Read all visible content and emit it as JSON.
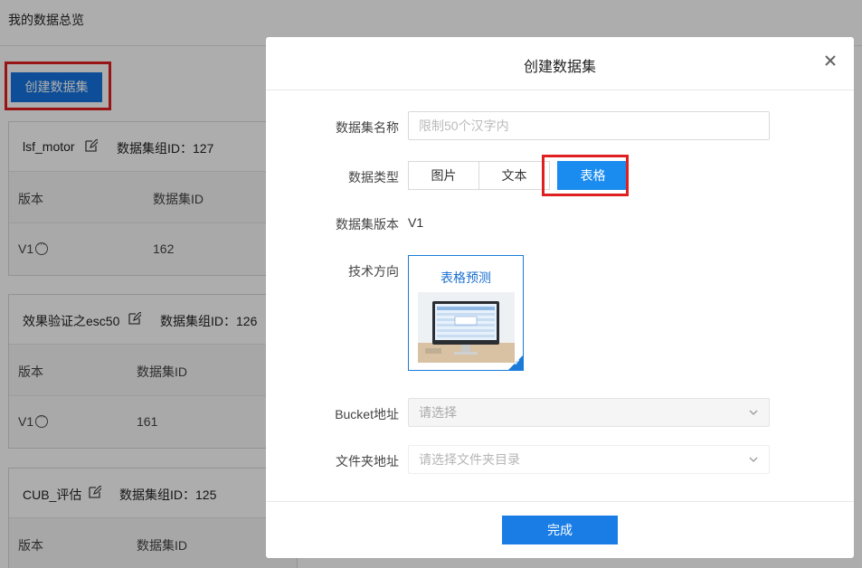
{
  "page": {
    "title": "我的数据总览",
    "create_button": "创建数据集"
  },
  "cards": [
    {
      "name": "lsf_motor",
      "group_id": "数据集组ID：127",
      "col_version": "版本",
      "col_id": "数据集ID",
      "version": "V1",
      "dataset_id": "162"
    },
    {
      "name": "效果验证之esc50",
      "group_id": "数据集组ID：126",
      "col_version": "版本",
      "col_id": "数据集ID",
      "version": "V1",
      "dataset_id": "161"
    },
    {
      "name": "CUB_评估",
      "group_id": "数据集组ID：125",
      "col_version": "版本",
      "col_id": "数据集ID"
    }
  ],
  "modal": {
    "title": "创建数据集",
    "name_label": "数据集名称",
    "name_placeholder": "限制50个汉字内",
    "type_label": "数据类型",
    "types": [
      "图片",
      "文本",
      "表格"
    ],
    "active_type": "表格",
    "version_label": "数据集版本",
    "version_value": "V1",
    "tech_label": "技术方向",
    "tech_option": "表格预测",
    "bucket_label": "Bucket地址",
    "bucket_placeholder": "请选择",
    "folder_label": "文件夹地址",
    "folder_placeholder": "请选择文件夹目录",
    "done_button": "完成"
  },
  "colors": {
    "primary": "#1a8cf0",
    "highlight": "#e02020"
  }
}
